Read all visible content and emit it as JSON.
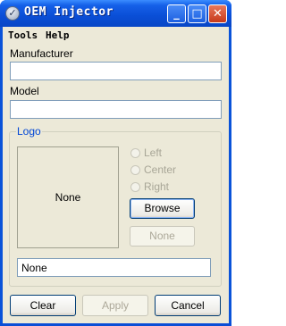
{
  "window": {
    "title": "OEM Injector",
    "icon": "check-circle-icon",
    "minimize_glyph": "_",
    "maximize_glyph": "□",
    "close_glyph": "✕"
  },
  "menu": {
    "tools": "Tools",
    "help": "Help"
  },
  "fields": {
    "manufacturer_label": "Manufacturer",
    "manufacturer_value": "",
    "model_label": "Model",
    "model_value": ""
  },
  "logo": {
    "group_title": "Logo",
    "preview_text": "None",
    "radio_left": "Left",
    "radio_center": "Center",
    "radio_right": "Right",
    "browse_label": "Browse",
    "none_button_label": "None",
    "path_value": "None"
  },
  "buttons": {
    "clear": "Clear",
    "apply": "Apply",
    "cancel": "Cancel"
  },
  "colors": {
    "titlebar": "#0a4ed6",
    "client_bg": "#ece9d8",
    "group_title": "#0046d5",
    "close_button": "#c6391b"
  }
}
